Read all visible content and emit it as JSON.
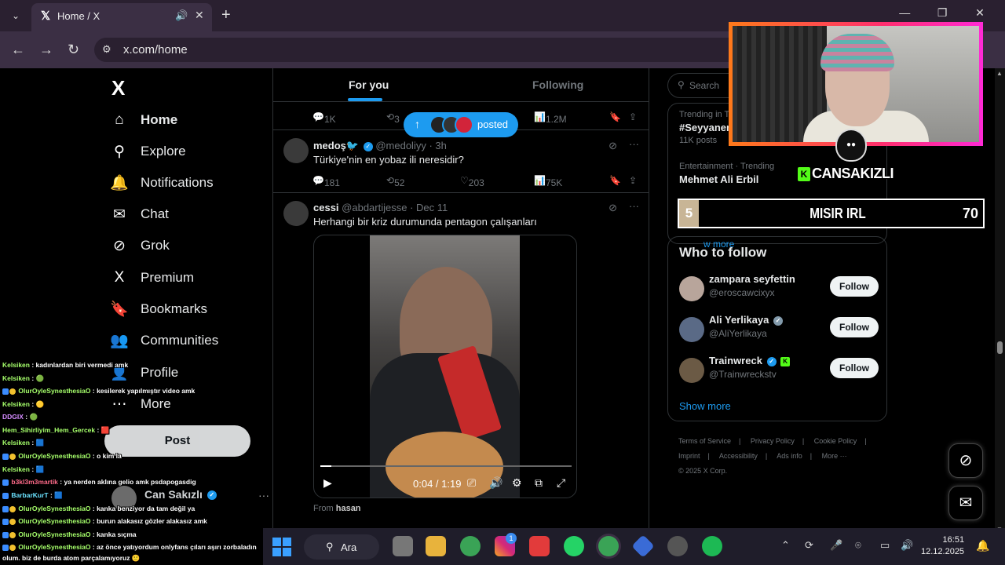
{
  "browser": {
    "tab_title": "Home / X",
    "url": "x.com/home",
    "new_tab_glyph": "+",
    "minimize_glyph": "—",
    "maximize_glyph": "❐",
    "close_glyph": "✕"
  },
  "sidebar": {
    "logo": "X",
    "items": [
      {
        "label": "Home",
        "icon": "⌂"
      },
      {
        "label": "Explore",
        "icon": "⚲"
      },
      {
        "label": "Notifications",
        "icon": "🔔"
      },
      {
        "label": "Chat",
        "icon": "✉"
      },
      {
        "label": "Grok",
        "icon": "⊘"
      },
      {
        "label": "Premium",
        "icon": "X"
      },
      {
        "label": "Bookmarks",
        "icon": "🔖"
      },
      {
        "label": "Communities",
        "icon": "👥"
      },
      {
        "label": "Profile",
        "icon": "👤"
      },
      {
        "label": "More",
        "icon": "⋯"
      }
    ],
    "post_label": "Post",
    "profile_name": "Can Sakızlı"
  },
  "timeline": {
    "tabs": {
      "for_you": "For you",
      "following": "Following"
    },
    "posted_pill": "posted",
    "prev_actions": {
      "replies": "1K",
      "reposts": "3",
      "views": "1.2M"
    },
    "tweets": [
      {
        "name": "medoş🐦",
        "handle": "@medoliyy · 3h",
        "text": "Türkiye'nin en yobaz ili neresidir?",
        "replies": "181",
        "reposts": "52",
        "likes": "203",
        "views": "75K"
      },
      {
        "name": "cessi",
        "handle": "@abdartijesse · Dec 11",
        "text": "Herhangi bir kriz durumunda pentagon çalışanları",
        "video_time": "0:04 / 1:19",
        "from_label": "From",
        "from_name": "hasan"
      }
    ]
  },
  "right": {
    "search_placeholder": "Search",
    "trends": [
      {
        "meta": "Trending in Tü",
        "title": "#SeyyanenZ",
        "count": "11K posts"
      },
      {
        "meta": "Entertainment · Trending",
        "title": "Mehmet Ali Erbil",
        "count": ""
      }
    ],
    "show_more_trends": "w more",
    "who_to_follow": {
      "title": "Who to follow",
      "users": [
        {
          "name": "zampara seyfettin",
          "handle": "@eroscawcixyx",
          "follow": "Follow"
        },
        {
          "name": "Ali Yerlikaya",
          "handle": "@AliYerlikaya",
          "follow": "Follow"
        },
        {
          "name": "Trainwreck",
          "handle": "@Trainwreckstv",
          "follow": "Follow"
        }
      ],
      "show_more": "Show more"
    },
    "footer": [
      "Terms of Service",
      "|",
      "Privacy Policy",
      "|",
      "Cookie Policy",
      "|",
      "Imprint",
      "|",
      "Accessibility",
      "|",
      "Ads info",
      "|",
      "More ···",
      "© 2025 X Corp."
    ]
  },
  "overlay": {
    "streamer": "CANSAKIZLI",
    "irl_rank": "5",
    "irl_title": "MISIR IRL",
    "irl_score": "70"
  },
  "chat": [
    {
      "user": "Kelsiken",
      "text": ": kadınlardan biri vermedi amk"
    },
    {
      "user": "Kelsiken",
      "text": ": 🟢"
    },
    {
      "user": "OlurOyleSynesthesiaO",
      "text": ": kesilerek yapılmıştır video amk"
    },
    {
      "user": "Kelsiken",
      "text": ": 🟡"
    },
    {
      "user": "DDGIX",
      "text": ": 🟢"
    },
    {
      "user": "Hem_Sihirliyim_Hem_Gercek",
      "text": ": 🟥"
    },
    {
      "user": "Kelsiken",
      "text": ": 🟦"
    },
    {
      "user": "OlurOyleSynesthesiaO",
      "text": ": o kim la"
    },
    {
      "user": "Kelsiken",
      "text": ": 🟦"
    },
    {
      "user": "b3kl3m3martik",
      "text": ": ya nerden aklına gelio amk psdapogasdig"
    },
    {
      "user": "BarbarKurT",
      "text": ": 🟦"
    },
    {
      "user": "OlurOyleSynesthesiaO",
      "text": ": kanka benziyor da tam değil ya"
    },
    {
      "user": "OlurOyleSynesthesiaO",
      "text": ": burun alakasız gözler alakasız amk"
    },
    {
      "user": "OlurOyleSynesthesiaO",
      "text": ": kanka sıçma"
    },
    {
      "user": "OlurOyleSynesthesiaO",
      "text": ": az önce yatıyordum onlyfans çıları aşırı zorbaladın"
    },
    {
      "user": "",
      "text": "olum. biz de burda atom parçalamıyoruz 🙂"
    }
  ],
  "taskbar": {
    "search_label": "Ara",
    "time": "16:51",
    "date": "12.12.2025",
    "instagram_badge": "1"
  },
  "colors": {
    "accent": "#1d9bf0",
    "bg": "#000000",
    "kick": "#53fc18"
  }
}
